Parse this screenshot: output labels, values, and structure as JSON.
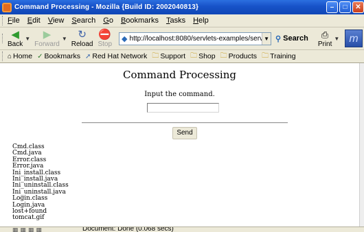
{
  "window": {
    "title": "Command Processing - Mozilla {Build ID: 2002040813}"
  },
  "menu": [
    "File",
    "Edit",
    "View",
    "Search",
    "Go",
    "Bookmarks",
    "Tasks",
    "Help"
  ],
  "nav": {
    "back": "Back",
    "forward": "Forward",
    "reload": "Reload",
    "stop": "Stop",
    "url": "http://localhost:8080/servlets-examples/serv",
    "search": "Search",
    "print": "Print"
  },
  "bookmarks": [
    "Home",
    "Bookmarks",
    "Red Hat Network",
    "Support",
    "Shop",
    "Products",
    "Training"
  ],
  "page": {
    "title": "Command Processing",
    "prompt": "Input the command.",
    "input_value": "",
    "send_label": "Send",
    "files": [
      "Cmd.class",
      "Cmd.java",
      "Error.class",
      "Error.java",
      "Ini_install.class",
      "Ini_install.java",
      "Ini_uninstall.class",
      "Ini_uninstall.java",
      "Login.class",
      "Login.java",
      "lost+found",
      "tomcat.gif"
    ]
  },
  "status": {
    "text": "Document: Done (0.068 secs)"
  }
}
